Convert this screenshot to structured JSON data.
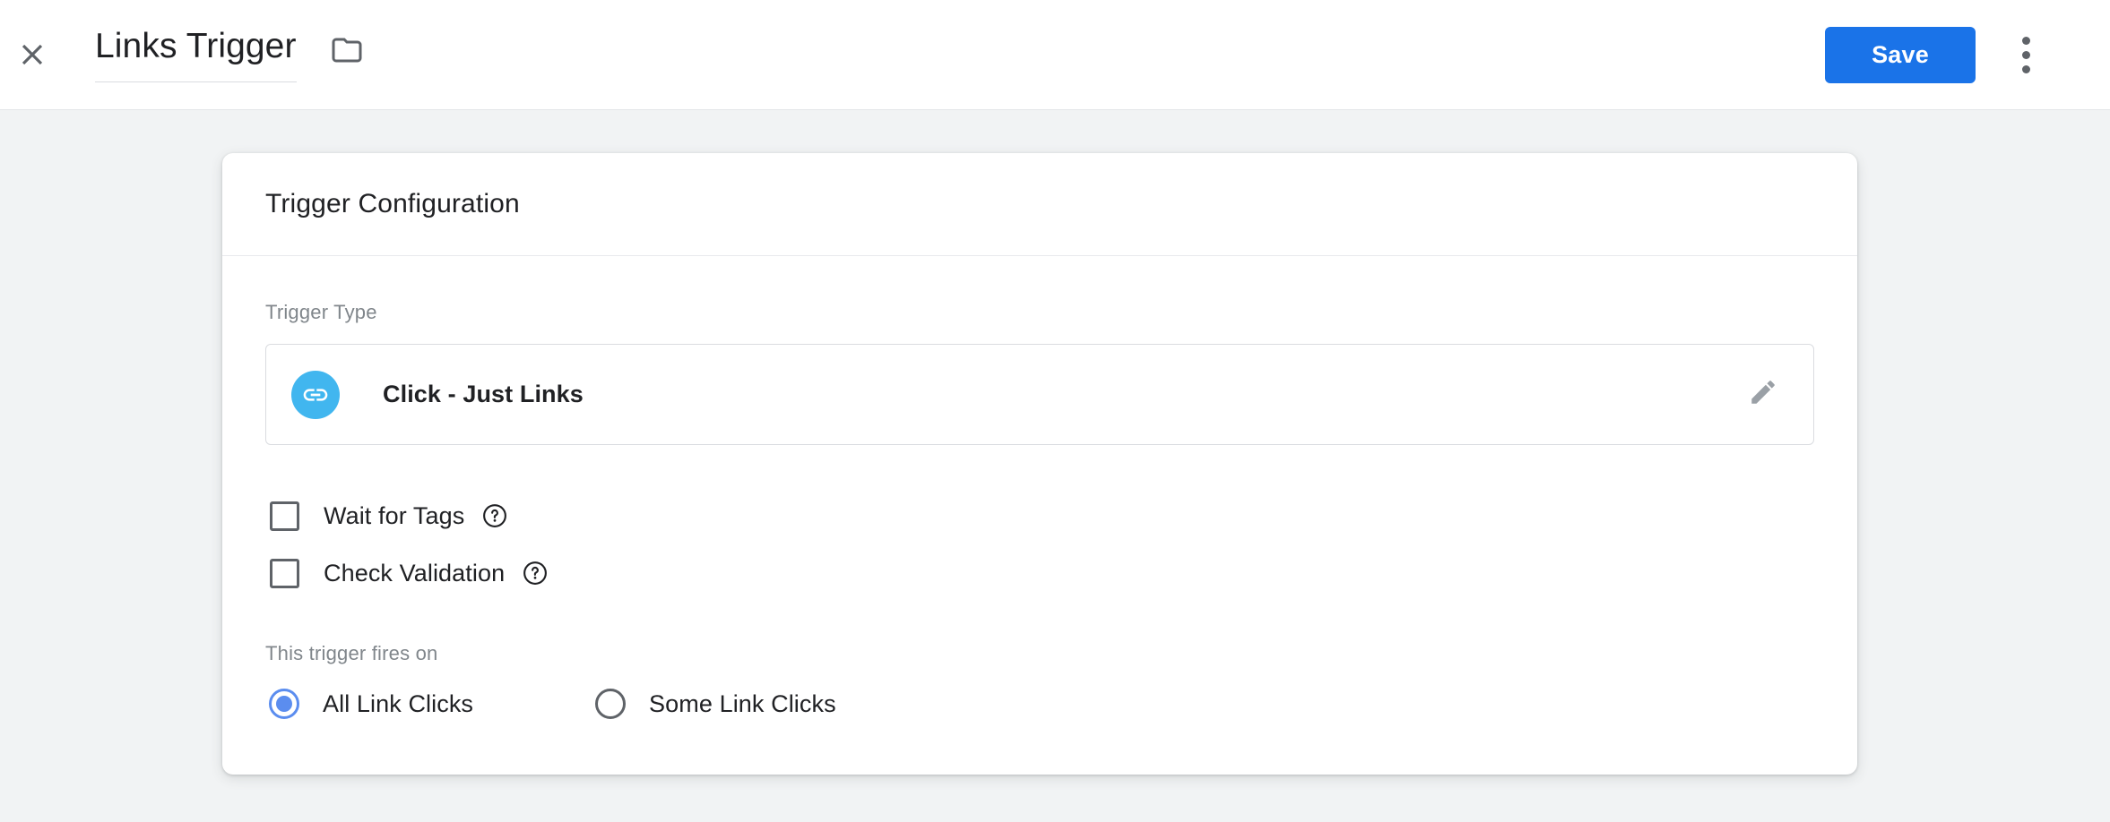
{
  "header": {
    "close_icon": "close-icon",
    "title": "Links Trigger",
    "folder_icon": "folder-icon",
    "save_label": "Save",
    "overflow_icon": "more-vert-icon",
    "accent_color": "#1a73e8"
  },
  "card": {
    "title": "Trigger Configuration",
    "trigger_type": {
      "label": "Trigger Type",
      "icon": "link-icon",
      "icon_color": "#41b6ef",
      "value": "Click - Just Links",
      "edit_icon": "pencil-icon"
    },
    "checkboxes": [
      {
        "label": "Wait for Tags",
        "checked": false,
        "help_icon": "help-circle-icon"
      },
      {
        "label": "Check Validation",
        "checked": false,
        "help_icon": "help-circle-icon"
      }
    ],
    "fires_on": {
      "label": "This trigger fires on",
      "options": [
        {
          "label": "All Link Clicks",
          "selected": true
        },
        {
          "label": "Some Link Clicks",
          "selected": false
        }
      ],
      "selected_color": "#5b8def"
    }
  }
}
